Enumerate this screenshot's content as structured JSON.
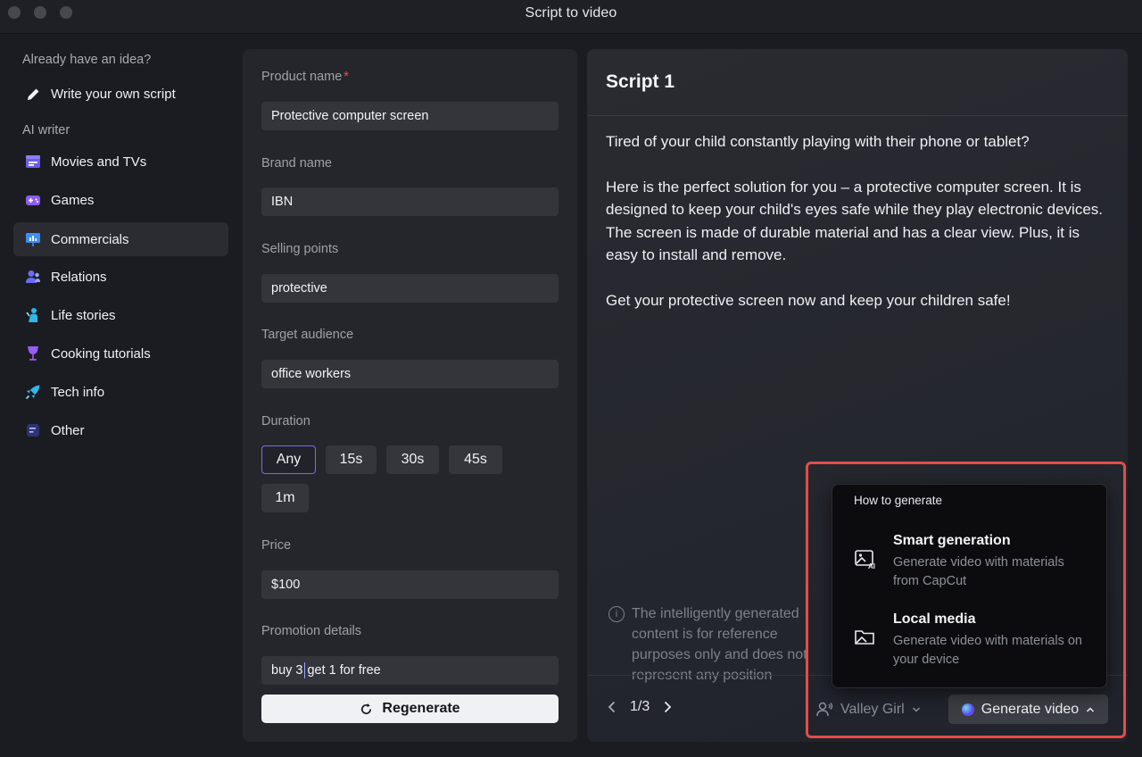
{
  "window": {
    "title": "Script to video"
  },
  "sidebar": {
    "heading_idea": "Already have an idea?",
    "write_own": "Write your own script",
    "heading_ai": "AI writer",
    "items": [
      {
        "label": "Movies and TVs",
        "icon": "clapperboard-icon",
        "color": "#6d5cf2"
      },
      {
        "label": "Games",
        "icon": "gamepad-icon",
        "color": "#8c5cf2"
      },
      {
        "label": "Commercials",
        "icon": "presentation-icon",
        "color": "#3d8ef6"
      },
      {
        "label": "Relations",
        "icon": "people-icon",
        "color": "#6a6cf5"
      },
      {
        "label": "Life stories",
        "icon": "person-icon",
        "color": "#2fb7e8"
      },
      {
        "label": "Cooking tutorials",
        "icon": "wine-glass-icon",
        "color": "#9b5cf5"
      },
      {
        "label": "Tech info",
        "icon": "rocket-icon",
        "color": "#32b8f0"
      },
      {
        "label": "Other",
        "icon": "document-icon",
        "color": "#4b56c9"
      }
    ],
    "active_index": 2
  },
  "form": {
    "product_name_label": "Product name",
    "required_mark": "*",
    "product_name_value": "Protective computer screen",
    "brand_name_label": "Brand name",
    "brand_name_value": "IBN",
    "selling_points_label": "Selling points",
    "selling_points_value": "protective",
    "target_audience_label": "Target audience",
    "target_audience_value": "office workers",
    "duration_label": "Duration",
    "durations": [
      "Any",
      "15s",
      "30s",
      "45s",
      "1m"
    ],
    "duration_selected": "Any",
    "price_label": "Price",
    "price_value": "$100",
    "promotion_label": "Promotion details",
    "promotion_value_before_caret": "buy 3",
    "promotion_value_after_caret": "get 1 for free",
    "regenerate_label": "Regenerate"
  },
  "script": {
    "title": "Script 1",
    "paragraphs": [
      "Tired of your child constantly playing with their phone or tablet?",
      "Here is the perfect solution for you – a protective computer screen. It is designed to keep your child's eyes safe while they play electronic devices. The screen is made of durable material and has a clear view. Plus, it is easy to install and remove.",
      "Get your protective screen now and keep your children safe!"
    ],
    "notice": "The intelligently generated content is for reference purposes only and does not represent any position",
    "page": "1/3",
    "voice": "Valley Girl",
    "generate_label": "Generate video"
  },
  "popup": {
    "title": "How to generate",
    "options": [
      {
        "title": "Smart generation",
        "desc": "Generate video with materials from CapCut",
        "icon": "ai-image-icon"
      },
      {
        "title": "Local media",
        "desc": "Generate video with materials on your device",
        "icon": "folder-media-icon"
      }
    ]
  },
  "colors": {
    "accent": "#7170e8",
    "highlight": "#e24d4a",
    "required": "#ef4a4a"
  }
}
